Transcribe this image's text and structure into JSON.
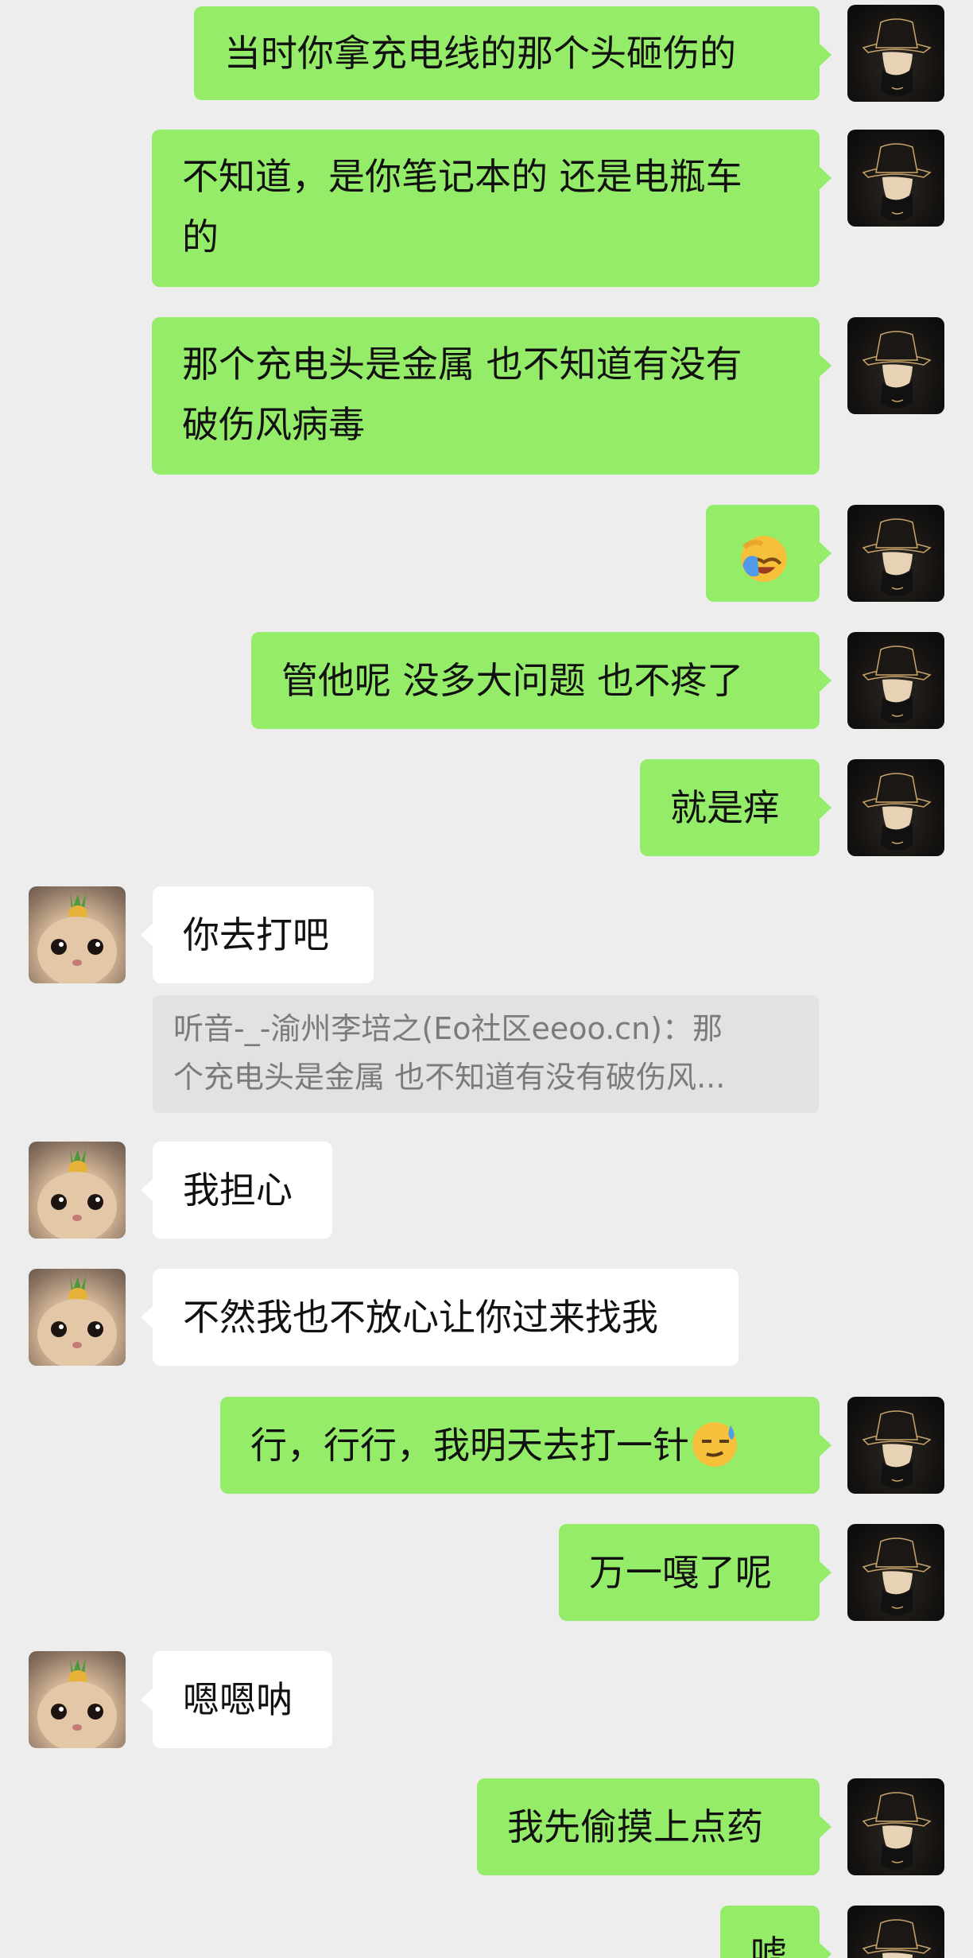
{
  "messages": [
    {
      "sender": "me",
      "text": "当时你拿充电线的那个头砸伤的"
    },
    {
      "sender": "me",
      "lines": [
        "不知道，是你笔记本的 还是电瓶车",
        "的"
      ]
    },
    {
      "sender": "me",
      "lines": [
        "那个充电头是金属 也不知道有没有",
        "破伤风病毒"
      ]
    },
    {
      "sender": "me",
      "emoji": "face-palm-emoji"
    },
    {
      "sender": "me",
      "text": "管他呢 没多大问题 也不疼了"
    },
    {
      "sender": "me",
      "text": "就是痒"
    },
    {
      "sender": "other",
      "text": "你去打吧"
    },
    {
      "sender": "other",
      "text": "我担心"
    },
    {
      "sender": "other",
      "text": "不然我也不放心让你过来找我"
    },
    {
      "sender": "me",
      "text": "行，行行，我明天去打一针",
      "emoji": "sweat-smile-emoji"
    },
    {
      "sender": "me",
      "text": "万一嘎了呢"
    },
    {
      "sender": "other",
      "text": "嗯嗯呐"
    },
    {
      "sender": "me",
      "text": "我先偷摸上点药"
    },
    {
      "sender": "me",
      "text": "唬"
    }
  ],
  "quote": {
    "line1": "听音-_-渝州李培之(Eo社区eeoo.cn)：那",
    "line2": "个充电头是金属 也不知道有没有破伤风..."
  },
  "colors": {
    "background": "#ededed",
    "my_bubble": "#95ec69",
    "their_bubble": "#ffffff",
    "quote_bg": "#e2e2e2",
    "quote_text": "#7b7b7b"
  }
}
